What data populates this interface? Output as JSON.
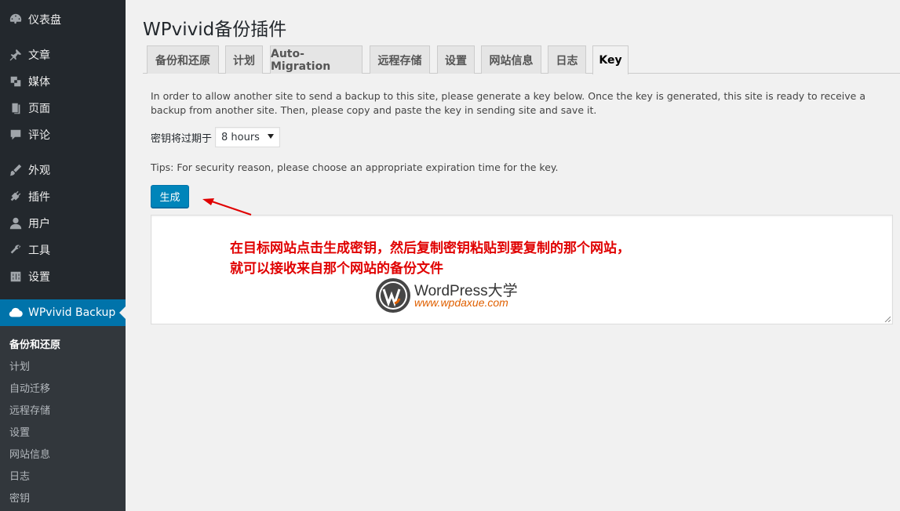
{
  "sidebar": {
    "items": [
      {
        "label": "仪表盘",
        "icon": "dashboard-icon"
      },
      {
        "label": "文章",
        "icon": "pin-icon"
      },
      {
        "label": "媒体",
        "icon": "media-icon"
      },
      {
        "label": "页面",
        "icon": "page-icon"
      },
      {
        "label": "评论",
        "icon": "comment-icon"
      },
      {
        "label": "外观",
        "icon": "brush-icon"
      },
      {
        "label": "插件",
        "icon": "plugin-icon"
      },
      {
        "label": "用户",
        "icon": "user-icon"
      },
      {
        "label": "工具",
        "icon": "wrench-icon"
      },
      {
        "label": "设置",
        "icon": "settings-icon"
      },
      {
        "label": "WPvivid Backup",
        "icon": "cloud-icon"
      }
    ],
    "submenu": [
      "备份和还原",
      "计划",
      "自动迁移",
      "远程存储",
      "设置",
      "网站信息",
      "日志",
      "密钥"
    ]
  },
  "header": {
    "title": "WPvivid备份插件"
  },
  "tabs": [
    "备份和还原",
    "计划",
    "Auto-Migration",
    "远程存储",
    "设置",
    "网站信息",
    "日志",
    "Key"
  ],
  "content": {
    "description": "In order to allow another site to send a backup to this site, please generate a key below. Once the key is generated, this site is ready to receive a backup from another site. Then, please copy and paste the key in sending site and save it.",
    "expire_label": "密钥将过期于",
    "expire_value": "8 hours",
    "tips": "Tips: For security reason, please choose an appropriate expiration time for the key.",
    "generate_label": "生成",
    "key_value": ""
  },
  "annotation": {
    "line1": "在目标网站点击生成密钥，然后复制密钥粘贴到要复制的那个网站，",
    "line2": "就可以接收来自那个网站的备份文件"
  },
  "watermark": {
    "brand": "WordPress大学",
    "url": "www.wpdaxue.com"
  },
  "colors": {
    "sidebar": "#23282d",
    "accent": "#0073aa",
    "button": "#0085ba",
    "annotation": "#e00000"
  }
}
